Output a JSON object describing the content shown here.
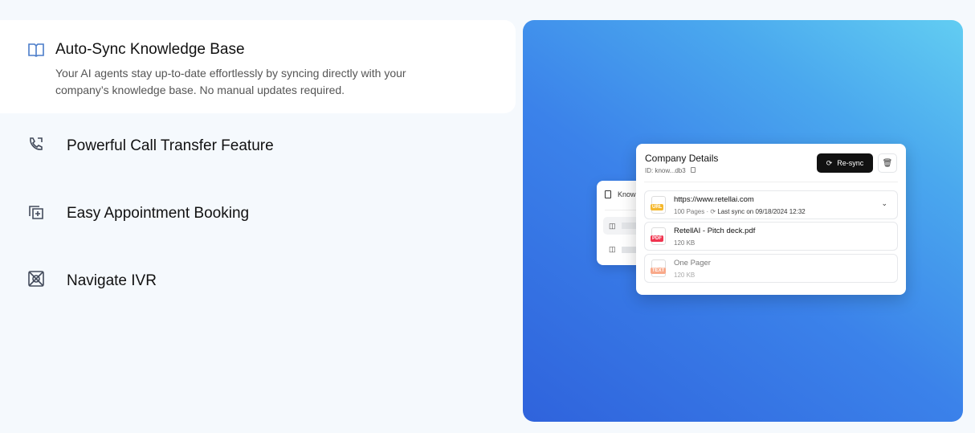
{
  "features": [
    {
      "title": "Auto-Sync Knowledge Base",
      "description": "Your AI agents stay up-to-date effortlessly by syncing directly with your company’s knowledge base. No manual updates required.",
      "icon": "book-open-icon",
      "active": true
    },
    {
      "title": "Powerful Call Transfer Feature",
      "icon": "phone-transfer-icon"
    },
    {
      "title": "Easy Appointment Booking",
      "icon": "calendar-add-icon"
    },
    {
      "title": "Navigate IVR",
      "icon": "ivr-icon"
    }
  ],
  "mock": {
    "back_card_label": "Know",
    "title": "Company Details",
    "id": "ID: know...db3",
    "resync": "Re-sync",
    "items": [
      {
        "tag": "URL",
        "tag_color": "#f5b82e",
        "name": "https://www.retellai.com",
        "pages": "100 Pages",
        "sync": "Last sync on 09/18/2024 12:32"
      },
      {
        "tag": "PDF",
        "tag_color": "#f0344f",
        "name": "RetellAI - Pitch deck.pdf",
        "size": "120 KB"
      },
      {
        "tag": "TEXT",
        "tag_color": "#f9a98a",
        "name": "One Pager",
        "size": "120 KB"
      }
    ]
  }
}
